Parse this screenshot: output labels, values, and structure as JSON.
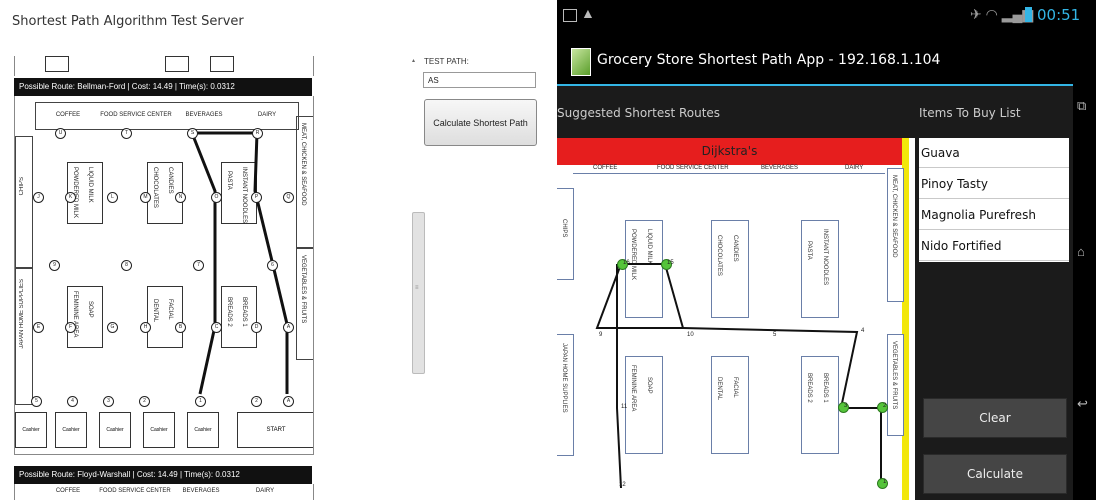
{
  "server": {
    "title": "Shortest Path Algorithm Test Server",
    "test_path_label": "TEST PATH:",
    "test_path_value": "AS",
    "calculate_button": "Calculate Shortest Path",
    "route1": "Possible Route: Bellman-Ford | Cost: 14.49 | Time(s): 0.0312",
    "route2": "Possible Route: Floyd-Warshall | Cost: 14.49 | Time(s): 0.0312",
    "aisles": [
      "COFFEE",
      "FOOD SERVICE CENTER",
      "BEVERAGES",
      "DAIRY"
    ],
    "aisles2": [
      "COFFEE",
      "FOOD SERVICE CENTER",
      "BEVERAGES",
      "DAIRY"
    ],
    "side_left_top": "CHIPS",
    "side_left_bottom": "JAPAN HOME SUPPLIES",
    "side_right_top": "MEAT, CHICKEN & SEAFOOD",
    "side_right_bottom": "VEGETABLES & FRUITS",
    "shelves": {
      "s1a": "POWDERED MILK",
      "s1b": "LIQUID MILK",
      "s2a": "CHOCOLATES",
      "s2b": "CANDIES",
      "s3a": "PASTA",
      "s3b": "INSTANT NOODLES",
      "s4a": "FEMININE AREA",
      "s4b": "SOAP",
      "s5a": "DENTAL",
      "s5b": "FACIAL",
      "s6a": "BREADS 2",
      "s6b": "BREADS 1"
    },
    "nodes": {
      "top": [
        "U",
        "T",
        "S",
        "R"
      ],
      "row1": [
        "J",
        "K",
        "L",
        "M",
        "N",
        "O",
        "P",
        "Q"
      ],
      "row2": [
        "9",
        "8",
        "7",
        "6"
      ],
      "row3": [
        "E",
        "F",
        "G",
        "H",
        "B",
        "C",
        "D",
        "A"
      ],
      "bottom": [
        "5",
        "4",
        "3",
        "2",
        "1",
        "2",
        "A"
      ]
    },
    "cashier": "Cashier",
    "start": "START"
  },
  "phone": {
    "app_title": "Grocery Store Shortest Path App - 192.168.1.104",
    "time": "00:51",
    "suggested_label": "Suggested Shortest Routes",
    "items_label": "Items To Buy List",
    "algorithm": "Dijkstra's",
    "items": [
      "Guava",
      "Pinoy Tasty",
      "Magnolia Purefresh",
      "Nido Fortified"
    ],
    "clear_button": "Clear",
    "calculate_button": "Calculate",
    "map_headers": [
      "COFFEE",
      "FOOD SERVICE CENTER",
      "BEVERAGES",
      "DAIRY"
    ],
    "map_side_left_top": "CHIPS",
    "map_side_left_bottom": "JAPAN HOME SUPPLIES",
    "map_side_right_top": "MEAT, CHICKEN & SEAFOOD",
    "map_side_right_bottom": "VEGETABLES & FRUITS",
    "map_shelves": {
      "a": "POWDERED MILK",
      "b": "LIQUID MILK",
      "c": "CHOCOLATES",
      "d": "CANDIES",
      "e": "PASTA",
      "f": "INSTANT NOODLES",
      "g": "FEMININE AREA",
      "h": "SOAP",
      "i": "DENTAL",
      "j": "FACIAL",
      "k": "BREADS 2",
      "l": "BREADS 1"
    },
    "map_node_labels": [
      "9",
      "10",
      "5",
      "4",
      "11",
      "12"
    ],
    "map_node_ids": [
      "16",
      "15",
      "3",
      "2",
      "1"
    ],
    "accent_color": "#33b5e5",
    "banner_color": "#e61e1e"
  }
}
